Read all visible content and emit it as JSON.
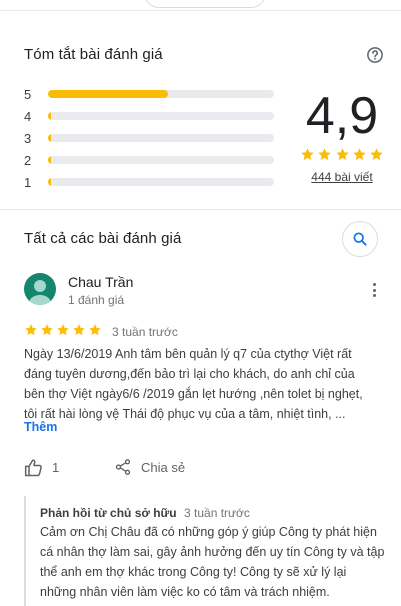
{
  "summary": {
    "title": "Tóm tắt bài đánh giá",
    "distribution": [
      {
        "stars": "5",
        "fraction": 0.53
      },
      {
        "stars": "4",
        "fraction": 0.01
      },
      {
        "stars": "3",
        "fraction": 0.01
      },
      {
        "stars": "2",
        "fraction": 0.01
      },
      {
        "stars": "1",
        "fraction": 0.01
      }
    ],
    "average": "4,9",
    "star_rating": 5,
    "review_count": "444 bài viết"
  },
  "all_reviews": {
    "title": "Tất cả các bài đánh giá"
  },
  "review": {
    "name": "Chau Trần",
    "sub": "1 đánh giá",
    "rating": 5,
    "time": "3 tuần trước",
    "text": "Ngày 13/6/2019 Anh tâm bên quản lý q7 của ctythợ Việt rất đáng tuyên dương,đến bảo trì lại cho khách, do anh chỉ của bên thợ Việt ngày6/6 /2019 gắn lẹt hướng ,nên tolet bị nghẹt, tôi rất hài lòng vệ Thái độ phục vụ của a tâm, nhiệt tình, ...",
    "more": "Thêm",
    "likes": "1",
    "share": "Chia sẻ"
  },
  "owner_reply": {
    "title": "Phản hồi từ chủ sở hữu",
    "time": "3 tuần trước",
    "text": "Cảm ơn Chị Châu đã có những góp ý giúp Công ty phát hiện cá nhân thợ làm sai, gây ảnh hưởng đến uy tín Công ty và tập thể anh em thợ khác trong Công ty! Công ty sẽ xử lý lại những nhân viên làm việc ko có tâm và trách nhiệm."
  },
  "colors": {
    "star": "#fbbc04",
    "link": "#1a73e8",
    "avatar": "#14866d"
  },
  "icons": [
    "help-icon",
    "search-icon",
    "more-vert-icon",
    "thumb-up-icon",
    "share-icon",
    "star-icon"
  ]
}
